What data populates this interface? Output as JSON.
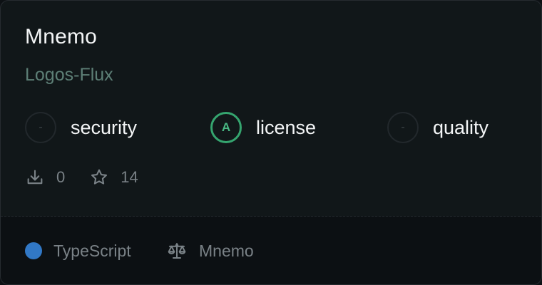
{
  "package": {
    "name": "Mnemo",
    "owner": "Logos-Flux"
  },
  "scores": [
    {
      "grade": "-",
      "label": "security",
      "status": "none"
    },
    {
      "grade": "A",
      "label": "license",
      "status": "good",
      "color": "#35a56f"
    },
    {
      "grade": "-",
      "label": "quality",
      "status": "none"
    }
  ],
  "stats": {
    "downloads": {
      "icon": "download-icon",
      "value": "0"
    },
    "stars": {
      "icon": "star-icon",
      "value": "14"
    }
  },
  "footer": {
    "language": {
      "name": "TypeScript",
      "color": "#3178c6"
    },
    "license": {
      "icon": "scale-icon",
      "name": "Mnemo"
    }
  },
  "colors": {
    "background": "#111719",
    "footer_background": "#0c1013",
    "owner": "#5d7f76",
    "muted": "#7a8287"
  }
}
